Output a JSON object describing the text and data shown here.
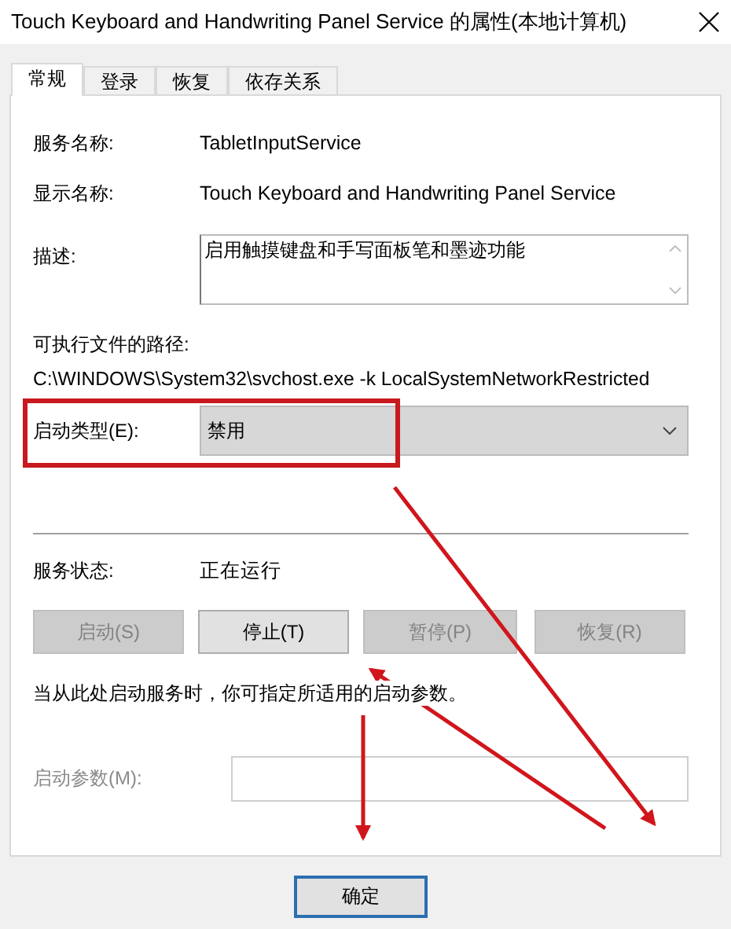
{
  "window": {
    "title": "Touch Keyboard and Handwriting Panel Service 的属性(本地计算机)"
  },
  "tabs": [
    {
      "label": "常规",
      "selected": true
    },
    {
      "label": "登录",
      "selected": false
    },
    {
      "label": "恢复",
      "selected": false
    },
    {
      "label": "依存关系",
      "selected": false
    }
  ],
  "fields": [
    {
      "label": "服务名称:",
      "value": "TabletInputService"
    },
    {
      "label": "显示名称:",
      "value": "Touch Keyboard and Handwriting Panel Service"
    }
  ],
  "description": {
    "label": "描述:",
    "value": "启用触摸键盘和手写面板笔和墨迹功能"
  },
  "executable_path": {
    "label": "可执行文件的路径:",
    "value": "C:\\WINDOWS\\System32\\svchost.exe -k LocalSystemNetworkRestricted"
  },
  "startup_type": {
    "label": "启动类型(E):",
    "value": "禁用"
  },
  "service_status": {
    "label": "服务状态:",
    "value": "正在运行"
  },
  "service_buttons": [
    {
      "label": "启动(S)",
      "disabled": true
    },
    {
      "label": "停止(T)",
      "disabled": false
    },
    {
      "label": "暂停(P)",
      "disabled": true
    },
    {
      "label": "恢复(R)",
      "disabled": true
    }
  ],
  "hint": "当从此处启动服务时，你可指定所适用的启动参数。",
  "start_parameters": {
    "label": "启动参数(M):",
    "disabled": true
  },
  "buttons": [
    {
      "label": "确定",
      "default": true
    }
  ]
}
